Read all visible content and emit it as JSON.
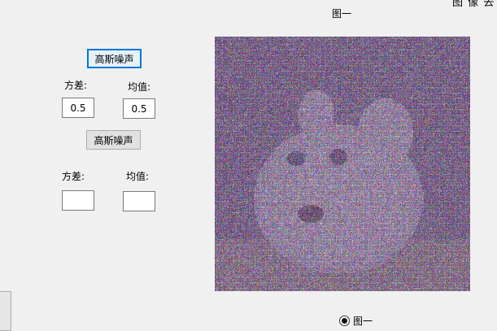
{
  "window": {
    "title_fragment_left": "· ·",
    "title_fragment_right": "图 像 去"
  },
  "figure_label": "图一",
  "group1": {
    "button_label": "高斯噪声",
    "variance_label": "方差:",
    "mean_label": "均值:",
    "variance_value": "0.5",
    "mean_value": "0.5"
  },
  "group2": {
    "button_label": "高斯噪声",
    "variance_label": "方差:",
    "mean_label": "均值:",
    "variance_value": "",
    "mean_value": ""
  },
  "radio": {
    "label": "图一",
    "checked": true
  }
}
